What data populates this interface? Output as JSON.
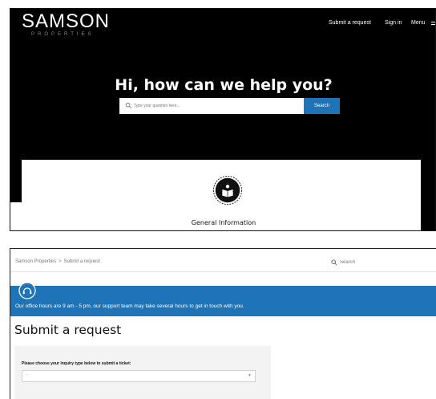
{
  "top": {
    "brand": {
      "name": "SAMSON",
      "tagline": "PROPERTIES"
    },
    "nav": {
      "submit_request": "Submit a request",
      "sign_in": "Sign in",
      "menu": "Menu"
    },
    "hero": {
      "title": "Hi, how can we help you?",
      "search_placeholder": "Type your question here...",
      "search_button": "Search"
    },
    "category": {
      "label": "General Information",
      "icon": "book-icon"
    }
  },
  "bottom": {
    "breadcrumb": [
      "Samson Properties",
      "Submit a request"
    ],
    "breadcrumb_separator": ">",
    "search_placeholder": "Search",
    "banner_text": "Our office hours are 9 am - 5 pm, our support team may take several hours to get in touch with you.",
    "page_title": "Submit a request",
    "form": {
      "label": "Please choose your inquiry type below to submit a ticket:",
      "select_value": "-",
      "select_arrow": "▾"
    }
  },
  "colors": {
    "hero_bg": "#000000",
    "accent": "#1f73b7",
    "form_bg": "#f3f3f3"
  }
}
